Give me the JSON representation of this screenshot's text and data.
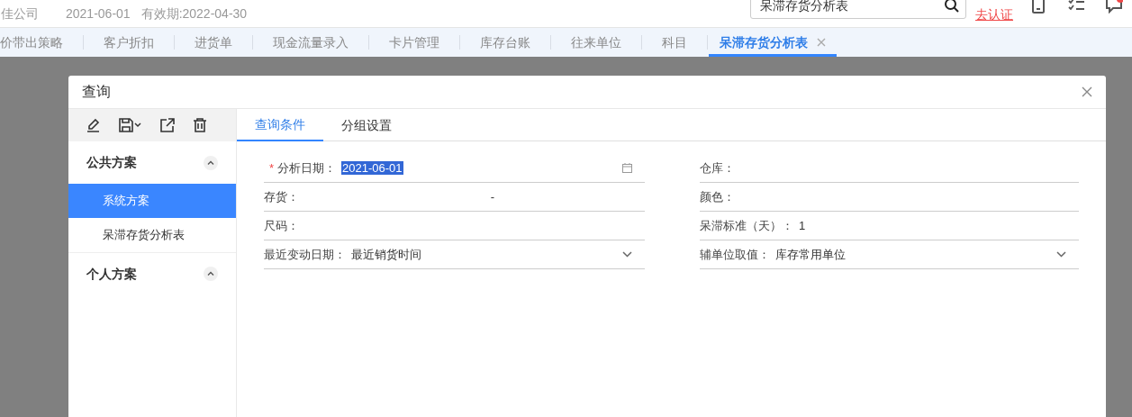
{
  "header": {
    "company": "佳公司",
    "date": "2021-06-01",
    "validity": "有效期:2022-04-30",
    "search": {
      "value": "呆滞存货分析表"
    },
    "verify_link": "去认证"
  },
  "tabs": [
    {
      "label": "价带出策略",
      "selected": false
    },
    {
      "label": "客户折扣",
      "selected": false
    },
    {
      "label": "进货单",
      "selected": false
    },
    {
      "label": "现金流量录入",
      "selected": false
    },
    {
      "label": "卡片管理",
      "selected": false
    },
    {
      "label": "库存台账",
      "selected": false
    },
    {
      "label": "往来单位",
      "selected": false
    },
    {
      "label": "科目",
      "selected": false
    },
    {
      "label": "呆滞存货分析表",
      "selected": true
    }
  ],
  "dialog": {
    "title": "查询",
    "scheme_groups": [
      {
        "label": "公共方案",
        "expanded": true,
        "items": [
          {
            "label": "系统方案",
            "selected": true
          },
          {
            "label": "呆滞存货分析表",
            "selected": false
          }
        ]
      },
      {
        "label": "个人方案",
        "expanded": true
      }
    ],
    "tabs": [
      {
        "label": "查询条件",
        "selected": true
      },
      {
        "label": "分组设置",
        "selected": false
      }
    ],
    "fields_left": [
      {
        "kind": "date",
        "label": "分析日期：",
        "required": true,
        "required_mark": "*",
        "value": "2021-06-01"
      },
      {
        "kind": "range",
        "label": "存货：",
        "required": false,
        "separator": "-"
      },
      {
        "kind": "text",
        "label": "尺码：",
        "required": false
      },
      {
        "kind": "select",
        "label": "最近变动日期：",
        "required": false,
        "value": "最近销货时间"
      }
    ],
    "fields_right": [
      {
        "kind": "text",
        "label": "仓库：",
        "required": false
      },
      {
        "kind": "text",
        "label": "颜色：",
        "required": false
      },
      {
        "kind": "text",
        "label": "呆滞标准（天）：",
        "required": false,
        "value": "1"
      },
      {
        "kind": "select",
        "label": "辅单位取值：",
        "required": false,
        "value": "库存常用单位"
      }
    ]
  }
}
